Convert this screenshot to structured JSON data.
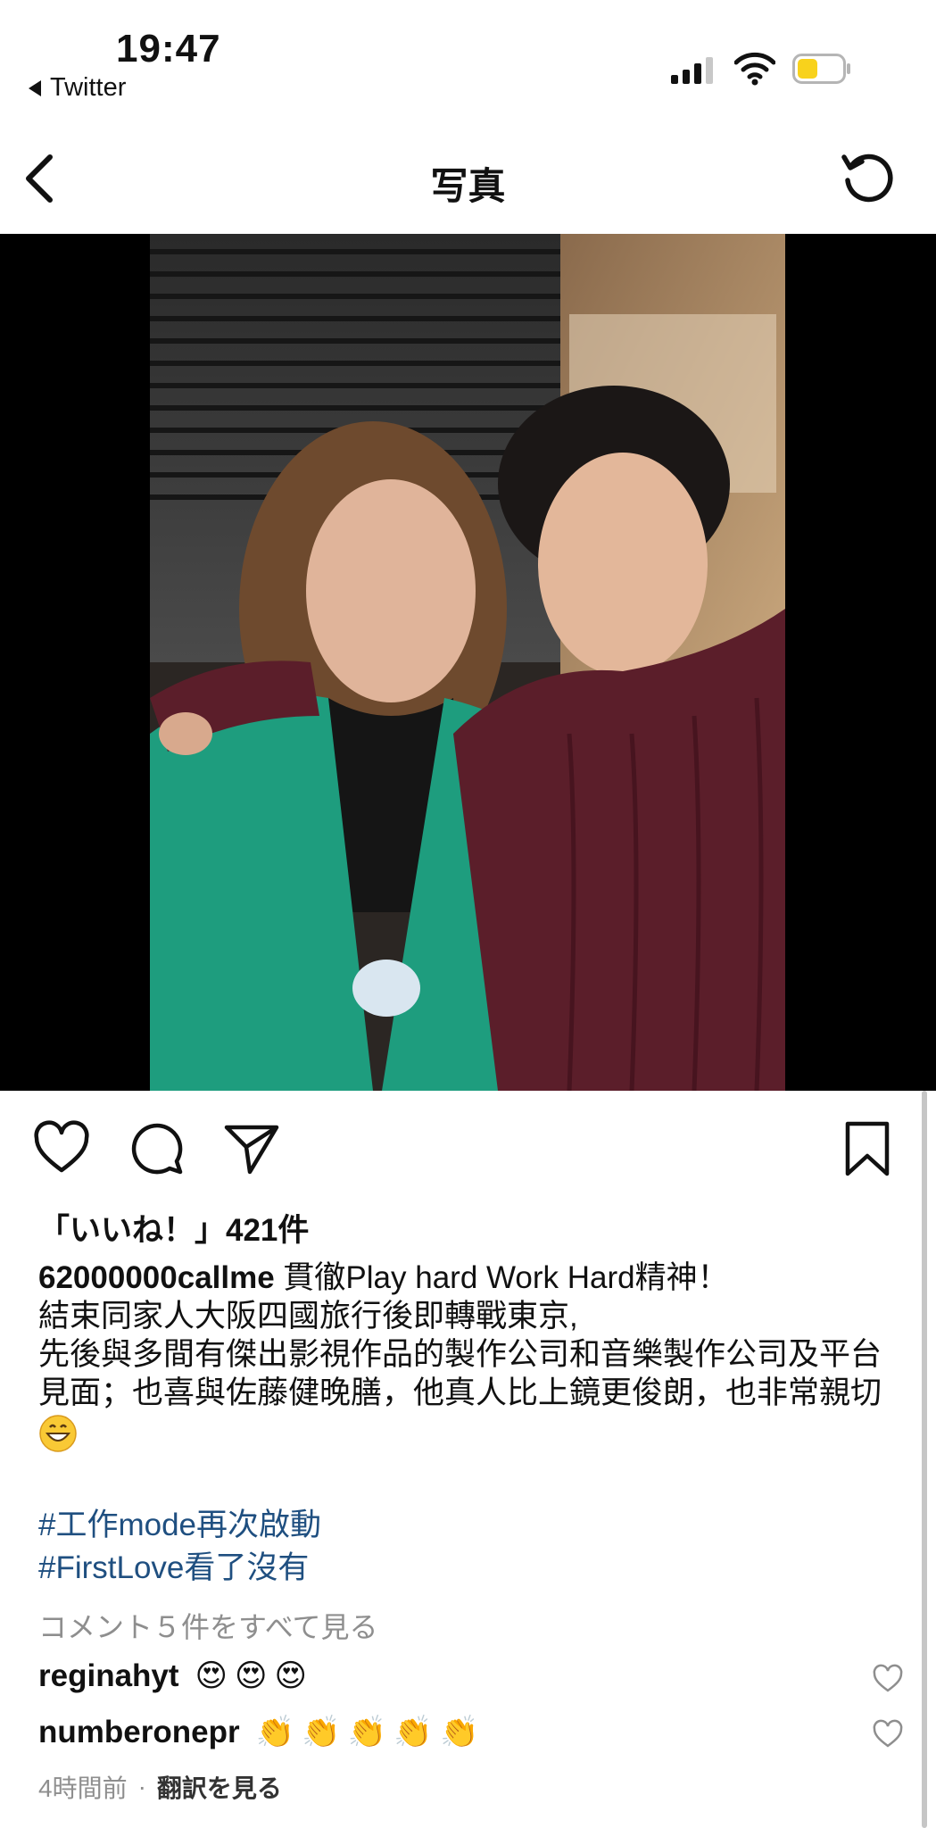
{
  "status_bar": {
    "time": "19:47",
    "back_app": "Twitter"
  },
  "header": {
    "title": "写真"
  },
  "post": {
    "likes": "「いいね！」421件",
    "username": "62000000callme",
    "caption_lines": [
      "貫徹Play hard Work Hard精神！",
      "結束同家人大阪四國旅行後即轉戰東京,",
      "先後與多間有傑出影視作品的製作公司和音樂製作公司及平台見面；也喜與佐藤健晚膳，他真人比上鏡更俊朗，也非常親切"
    ],
    "hashtags": [
      "#工作mode再次啟動",
      "#FirstLove看了沒有"
    ],
    "view_comments": "コメント５件をすべて見る",
    "comments": [
      {
        "user": "reginahyt",
        "emoji": [
          "😍",
          "😍",
          "😍"
        ]
      },
      {
        "user": "numberonepr",
        "emoji": [
          "👏",
          "👏",
          "👏",
          "👏",
          "👏"
        ]
      }
    ],
    "time_ago": "4時間前",
    "separator": "·",
    "translate": "翻訳を見る"
  },
  "colors": {
    "hashtag": "#1f4f80",
    "muted": "#8e8e8e",
    "battery": "#f8d21c"
  },
  "icons": [
    "back-chevron-icon",
    "refresh-icon",
    "heart-icon",
    "comment-icon",
    "share-icon",
    "bookmark-icon"
  ]
}
